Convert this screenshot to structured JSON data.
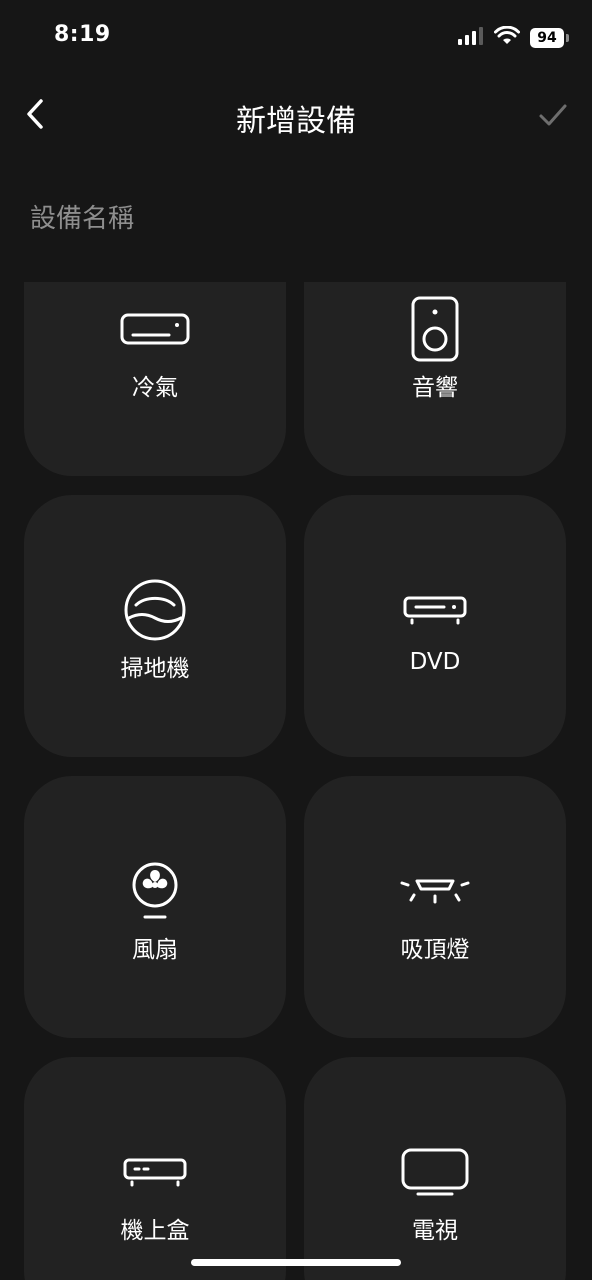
{
  "status_bar": {
    "time": "8:19",
    "battery": "94",
    "signal_icon": "cellular-signal-icon",
    "wifi_icon": "wifi-icon"
  },
  "nav": {
    "title": "新增設備",
    "back_icon": "chevron-left-icon",
    "confirm_icon": "checkmark-icon"
  },
  "form": {
    "device_name_placeholder": "設備名稱"
  },
  "devices": [
    {
      "label": "冷氣",
      "icon": "air-conditioner-icon"
    },
    {
      "label": "音響",
      "icon": "speaker-icon"
    },
    {
      "label": "掃地機",
      "icon": "robot-vacuum-icon"
    },
    {
      "label": "DVD",
      "icon": "dvd-player-icon"
    },
    {
      "label": "風扇",
      "icon": "fan-icon"
    },
    {
      "label": "吸頂燈",
      "icon": "ceiling-light-icon"
    },
    {
      "label": "機上盒",
      "icon": "set-top-box-icon"
    },
    {
      "label": "電視",
      "icon": "tv-icon"
    }
  ],
  "colors": {
    "background": "#161616",
    "tile": "#222222",
    "placeholder_text": "#8e8e8e"
  }
}
